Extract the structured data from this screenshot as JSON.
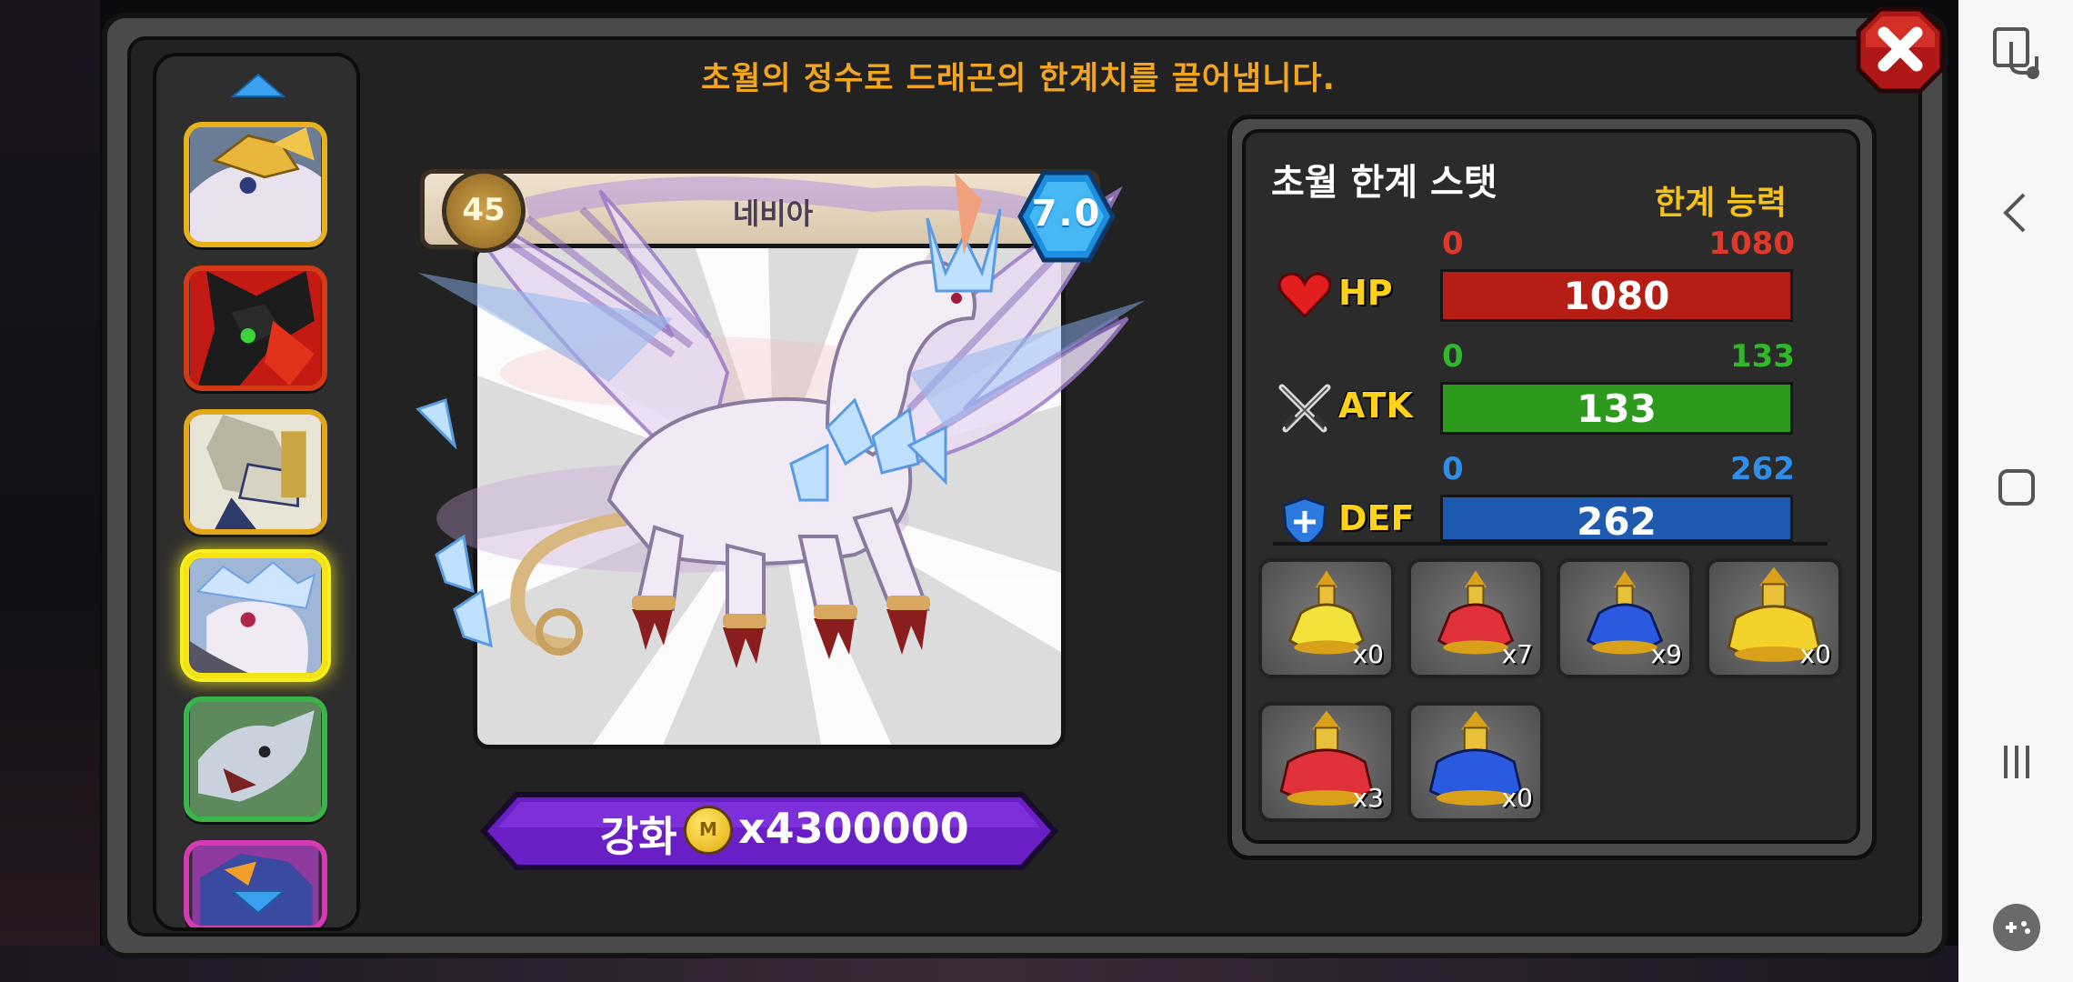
{
  "header": {
    "title": "초월의 정수로 드래곤의 한계치를 끌어냅니다."
  },
  "dragon_list": {
    "items": [
      {
        "name": "white-gold-dragon"
      },
      {
        "name": "red-dark-dragon"
      },
      {
        "name": "armored-gold-dragon"
      },
      {
        "name": "crystal-dragon",
        "selected": true
      },
      {
        "name": "green-dragon"
      },
      {
        "name": "pink-dragon"
      }
    ]
  },
  "dragon": {
    "level": "45",
    "name": "네비아",
    "grade": "7.0"
  },
  "upgrade": {
    "label": "강화",
    "coin_icon": "gold-coin-icon",
    "cost": "x4300000"
  },
  "stats": {
    "title": "초월 한계 스탯",
    "limit_label": "한계 능력",
    "items": [
      {
        "label": "HP",
        "min": "0",
        "max": "1080",
        "value": "1080",
        "fill": 1.0,
        "color": "#b41e14",
        "min_color": "#e0382a",
        "max_color": "#e0382a"
      },
      {
        "label": "ATK",
        "min": "0",
        "max": "133",
        "value": "133",
        "fill": 1.0,
        "color": "#2d9a1e",
        "min_color": "#30b82a",
        "max_color": "#30b82a"
      },
      {
        "label": "DEF",
        "min": "0",
        "max": "262",
        "value": "262",
        "fill": 1.0,
        "color": "#1e5bb0",
        "min_color": "#2f8ee8",
        "max_color": "#2f8ee8"
      }
    ]
  },
  "essences": [
    {
      "icon": "yellow-essence-flask-icon",
      "count": "x0"
    },
    {
      "icon": "red-essence-flask-icon",
      "count": "x7"
    },
    {
      "icon": "blue-essence-flask-icon",
      "count": "x9"
    },
    {
      "icon": "large-yellow-essence-flask-icon",
      "count": "x0"
    },
    {
      "icon": "large-red-essence-flask-icon",
      "count": "x3"
    },
    {
      "icon": "large-blue-essence-flask-icon",
      "count": "x0"
    }
  ],
  "colors": {
    "title": "#f2a51f",
    "limit": "#f4c21a",
    "upgrade_button": "#6a1ec6",
    "selected": "#f4e415"
  }
}
